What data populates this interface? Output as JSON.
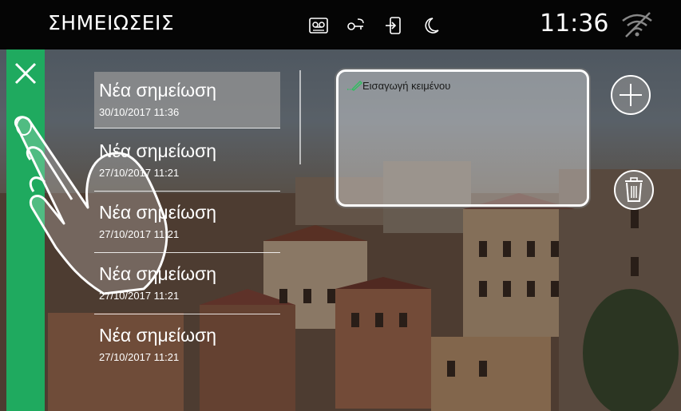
{
  "topbar": {
    "title": "ΣΗΜΕΙΩΣΕΙΣ",
    "clock": "11:36",
    "status_icons": [
      "voicemail-icon",
      "door-key-icon",
      "intercom-divert-icon",
      "night-mode-icon"
    ],
    "wifi_icon": "wifi-disconnected-icon"
  },
  "close_button": {
    "icon": "close-icon"
  },
  "notes": [
    {
      "title": "Νέα σημείωση",
      "date": "30/10/2017 11:36",
      "selected": true
    },
    {
      "title": "Νέα σημείωση",
      "date": "27/10/2017 11:21",
      "selected": false
    },
    {
      "title": "Νέα σημείωση",
      "date": "27/10/2017 11:21",
      "selected": false
    },
    {
      "title": "Νέα σημείωση",
      "date": "27/10/2017 11:21",
      "selected": false
    },
    {
      "title": "Νέα σημείωση",
      "date": "27/10/2017 11:21",
      "selected": false
    }
  ],
  "editor": {
    "placeholder": "Εισαγωγή κειμένου",
    "icon": "pencil-icon"
  },
  "actions": {
    "add_icon": "plus-icon",
    "delete_icon": "trash-icon"
  },
  "colors": {
    "accent": "#1faa5f",
    "topbar": "#050505",
    "pencil": "#2fbf5f"
  }
}
